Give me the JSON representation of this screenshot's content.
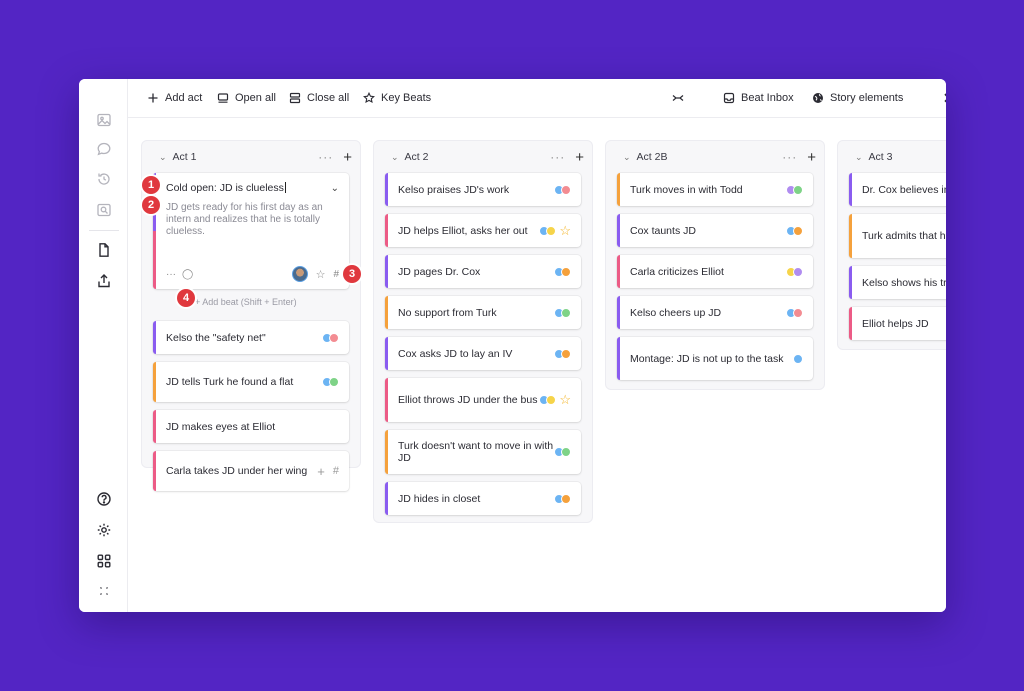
{
  "toolbar": {
    "add_act": "Add act",
    "open_all": "Open all",
    "close_all": "Close all",
    "key_beats": "Key Beats",
    "beat_inbox": "Beat Inbox",
    "story_elements": "Story elements"
  },
  "colors": {
    "purple": "#8a5cf0",
    "pink": "#ec5b86",
    "orange": "#f5a13c",
    "blue": "#6cb4f3",
    "red": "#f38c92",
    "green": "#7ed387",
    "yellow": "#f6d44a",
    "lavender": "#b08cf0",
    "star": "#f3b11c"
  },
  "acts": [
    {
      "title": "Act 1",
      "expanded_card": {
        "title": "Cold open: JD is clueless",
        "description": "JD gets ready for his first day as an intern and realizes that he is totally clueless.",
        "footer_dots": "···",
        "hash": "#"
      },
      "add_beat": "+ Add beat (Shift + Enter)",
      "cards": [
        {
          "text": "Kelso the \"safety net\"",
          "bar": "purple",
          "tags": [
            "blue",
            "red"
          ]
        },
        {
          "text": "JD tells Turk he found a flat",
          "bar": "orange",
          "tags": [
            "blue",
            "green"
          ]
        },
        {
          "text": "JD makes eyes at Elliot",
          "bar": "pink",
          "tags": []
        },
        {
          "text": "Carla takes JD under her wing",
          "bar": "pink",
          "tags": [],
          "hover": true
        }
      ]
    },
    {
      "title": "Act 2",
      "cards": [
        {
          "text": "Kelso praises JD's work",
          "bar": "purple",
          "tags": [
            "blue",
            "red"
          ]
        },
        {
          "text": "JD helps Elliot, asks her out",
          "bar": "pink",
          "tags": [
            "blue",
            "yellow"
          ],
          "star": true
        },
        {
          "text": "JD pages Dr. Cox",
          "bar": "purple",
          "tags": [
            "blue",
            "orange"
          ]
        },
        {
          "text": "No support from Turk",
          "bar": "orange",
          "tags": [
            "blue",
            "green"
          ]
        },
        {
          "text": "Cox asks JD to lay an IV",
          "bar": "purple",
          "tags": [
            "blue",
            "orange"
          ]
        },
        {
          "text": "Elliot throws JD under the bus",
          "bar": "pink",
          "tags": [
            "blue",
            "yellow"
          ],
          "star": true
        },
        {
          "text": "Turk doesn't want to move in with JD",
          "bar": "orange",
          "tags": [
            "blue",
            "green"
          ]
        },
        {
          "text": "JD hides in closet",
          "bar": "purple",
          "tags": [
            "blue",
            "orange"
          ]
        }
      ]
    },
    {
      "title": "Act 2B",
      "cards": [
        {
          "text": "Turk moves in with Todd",
          "bar": "orange",
          "tags": [
            "lavender",
            "green"
          ]
        },
        {
          "text": "Cox taunts JD",
          "bar": "purple",
          "tags": [
            "blue",
            "orange"
          ]
        },
        {
          "text": "Carla criticizes Elliot",
          "bar": "pink",
          "tags": [
            "yellow",
            "lavender"
          ]
        },
        {
          "text": "Kelso cheers up JD",
          "bar": "purple",
          "tags": [
            "blue",
            "red"
          ]
        },
        {
          "text": "Montage: JD is not up to the task",
          "bar": "purple",
          "tags": [
            "blue"
          ]
        }
      ]
    },
    {
      "title": "Act 3",
      "cards": [
        {
          "text": "Dr. Cox believes in",
          "bar": "purple",
          "tags": []
        },
        {
          "text": "Turk admits that he too",
          "bar": "orange",
          "tags": []
        },
        {
          "text": "Kelso shows his tr",
          "bar": "purple",
          "tags": []
        },
        {
          "text": "Elliot helps JD",
          "bar": "pink",
          "tags": []
        }
      ]
    }
  ],
  "badges": [
    "1",
    "2",
    "3",
    "4"
  ]
}
